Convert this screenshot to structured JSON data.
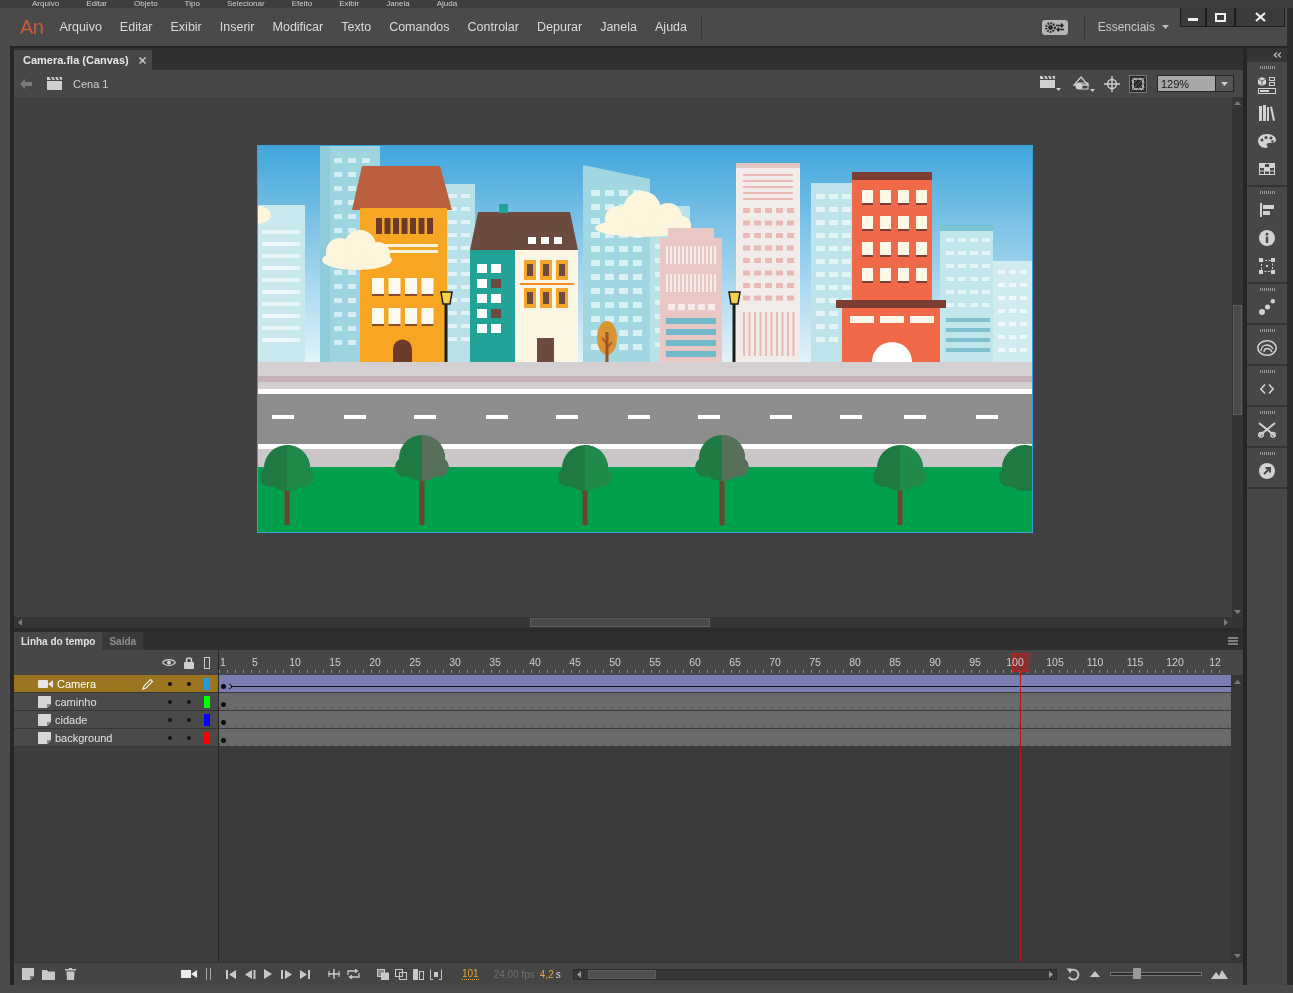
{
  "background_app": {
    "menu": [
      "Arquivo",
      "Editar",
      "Objeto",
      "Tipo",
      "Selecionar",
      "Efeito",
      "Exibir",
      "Janela",
      "Ajuda"
    ]
  },
  "window": {
    "logo": "An",
    "menu": [
      "Arquivo",
      "Editar",
      "Exibir",
      "Inserir",
      "Modificar",
      "Texto",
      "Comandos",
      "Controlar",
      "Depurar",
      "Janela",
      "Ajuda"
    ],
    "workspace": "Essenciais"
  },
  "document_tabs": [
    {
      "label": "Camera.fla (Canvas)",
      "selected": true
    }
  ],
  "scene_bar": {
    "scene": "Cena 1",
    "clip_content": {
      "on": true
    },
    "zoom": "129%"
  },
  "timeline": {
    "tabs": [
      {
        "label": "Linha do tempo",
        "selected": true
      },
      {
        "label": "Saída",
        "selected": false
      }
    ],
    "frame_numbers": [
      "1",
      "5",
      "10",
      "15",
      "20",
      "25",
      "30",
      "35",
      "40",
      "45",
      "50",
      "55",
      "60",
      "65",
      "70",
      "75",
      "80",
      "85",
      "90",
      "95",
      "100",
      "105",
      "110",
      "115",
      "120",
      "12"
    ],
    "playhead": {
      "level": 0.783
    },
    "layers": [
      {
        "name": "Camera",
        "kind": "camera",
        "selected": true,
        "visible": true,
        "locked": false,
        "color": "#1e9be6",
        "tween": true
      },
      {
        "name": "caminho",
        "kind": "layer",
        "selected": false,
        "visible": true,
        "locked": false,
        "color": "#00ff00",
        "tween": false
      },
      {
        "name": "cidade",
        "kind": "layer",
        "selected": false,
        "visible": true,
        "locked": false,
        "color": "#0000ff",
        "tween": false
      },
      {
        "name": "background",
        "kind": "layer",
        "selected": false,
        "visible": true,
        "locked": false,
        "color": "#ff0000",
        "tween": false
      }
    ],
    "current_frame": "101",
    "frame_rate": "24,00 fps",
    "elapsed_time": "4,2",
    "elapsed_unit": "s",
    "frame_size_slider": {
      "level": 0.29
    }
  }
}
